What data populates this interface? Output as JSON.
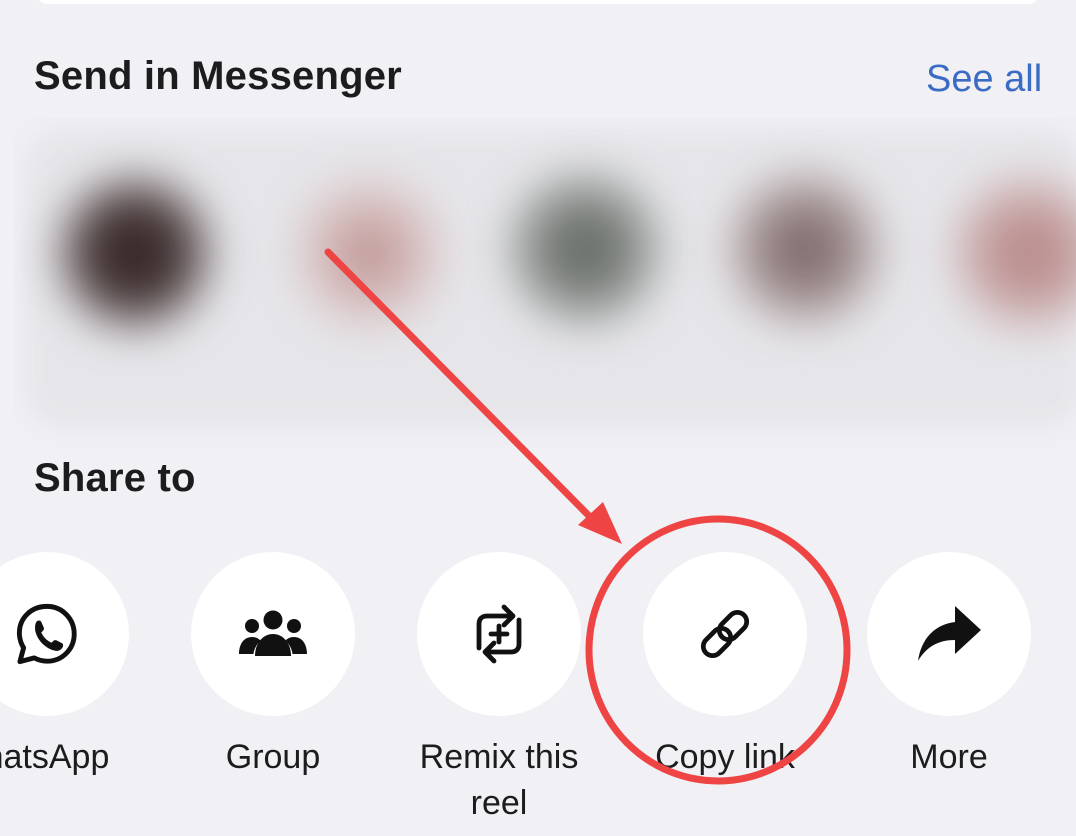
{
  "messenger": {
    "title": "Send in Messenger",
    "see_all": "See all"
  },
  "share": {
    "title": "Share to",
    "items": [
      {
        "label": "hatsApp",
        "icon": "whatsapp-icon"
      },
      {
        "label": "Group",
        "icon": "group-icon"
      },
      {
        "label": "Remix this reel",
        "icon": "remix-icon"
      },
      {
        "label": "Copy link",
        "icon": "link-icon"
      },
      {
        "label": "More",
        "icon": "share-arrow-icon"
      }
    ]
  },
  "colors": {
    "background": "#f0f0f5",
    "link": "#3b6cc4",
    "annotation": "#ef4444"
  }
}
